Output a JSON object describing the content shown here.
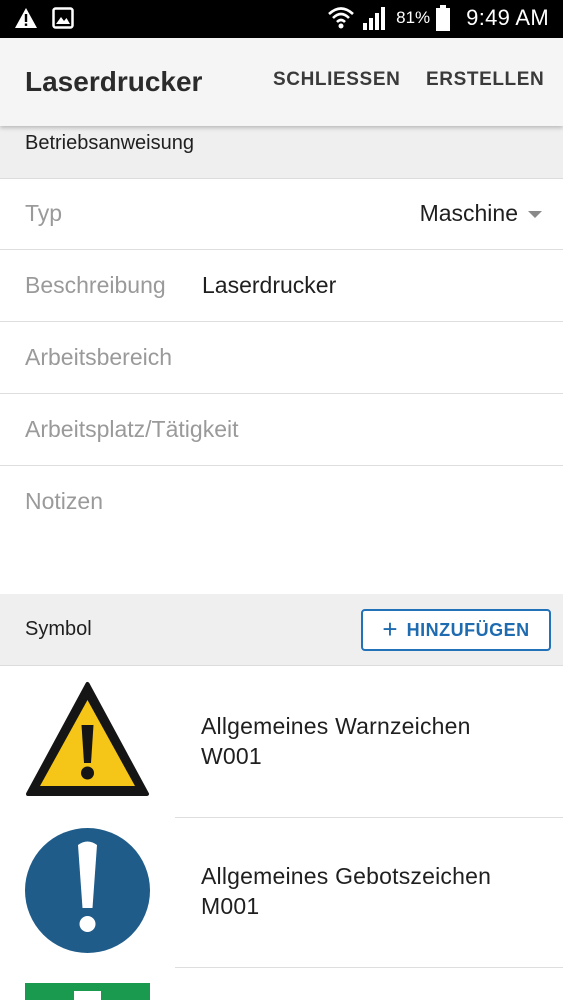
{
  "status_bar": {
    "battery": "81%",
    "time": "9:49 AM",
    "icons": [
      "warning-icon",
      "image-icon",
      "wifi-icon",
      "signal-icon",
      "battery-icon"
    ]
  },
  "appbar": {
    "title": "Laserdrucker",
    "close_label": "SCHLIESSEN",
    "create_label": "ERSTELLEN"
  },
  "form": {
    "section_title": "Betriebsanweisung",
    "typ": {
      "label": "Typ",
      "value": "Maschine"
    },
    "beschreibung": {
      "label": "Beschreibung",
      "value": "Laserdrucker"
    },
    "arbeitsbereich": {
      "label": "Arbeitsbereich"
    },
    "arbeitsplatz": {
      "label": "Arbeitsplatz/Tätigkeit"
    },
    "notizen": {
      "label": "Notizen"
    }
  },
  "symbols": {
    "section_title": "Symbol",
    "add_label": "HINZUFÜGEN",
    "items": [
      {
        "name": "Allgemeines Warnzeichen",
        "code": "W001",
        "icon": "warning-sign-icon"
      },
      {
        "name": "Allgemeines Gebotszeichen",
        "code": "M001",
        "icon": "mandatory-sign-icon"
      }
    ]
  },
  "colors": {
    "warning_yellow": "#f5c518",
    "mandatory_blue": "#1f5c8a",
    "safety_green": "#1a9a4e",
    "accent_blue": "#1e6bb0"
  }
}
